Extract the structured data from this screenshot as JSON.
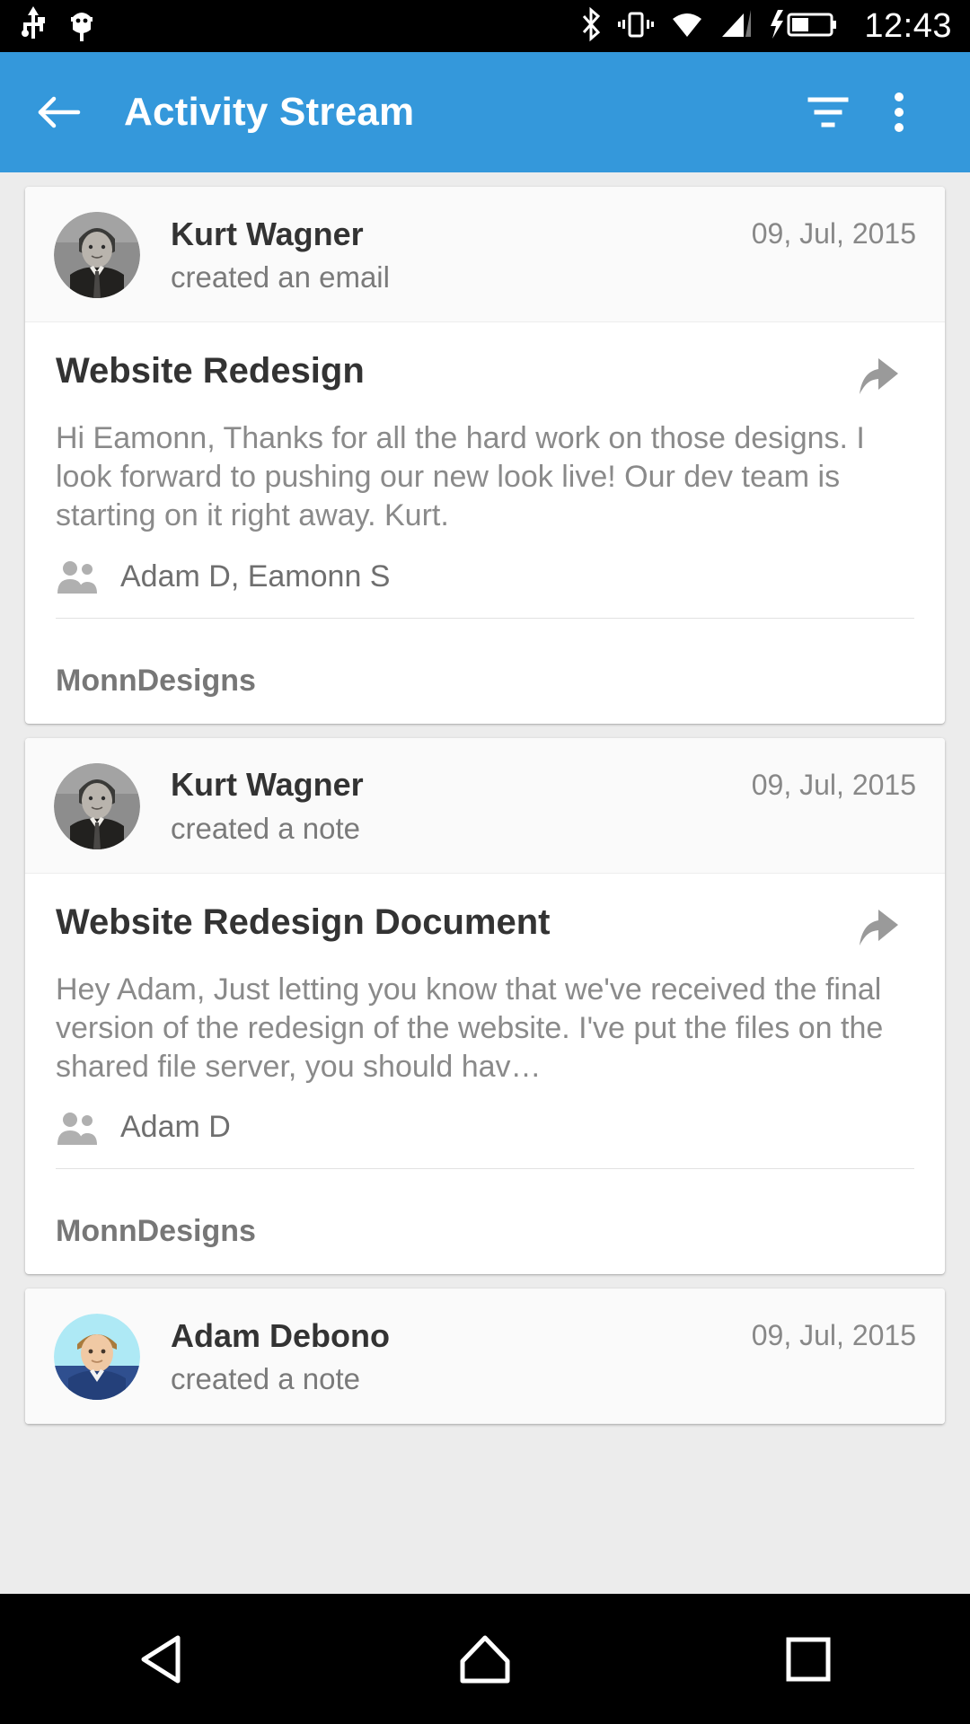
{
  "status_bar": {
    "time": "12:43",
    "icons": [
      "usb-icon",
      "android-debug-icon",
      "bluetooth-icon",
      "vibrate-icon",
      "wifi-icon",
      "cellular-signal-icon",
      "charging-battery-icon"
    ]
  },
  "app_bar": {
    "title": "Activity Stream",
    "back_icon": "back-arrow-icon",
    "filter_icon": "filter-icon",
    "overflow_icon": "overflow-menu-icon"
  },
  "activities": [
    {
      "author": "Kurt Wagner",
      "action": "created an email",
      "date": "09, Jul, 2015",
      "avatar_type": "photo-grayscale-man",
      "title": "Website Redesign",
      "body": "Hi Eamonn, Thanks for all the hard work on those designs. I look forward to pushing our new look live! Our dev team is starting on it right away. Kurt.",
      "participants": "Adam D, Eamonn S",
      "footer": "MonnDesigns",
      "reply_icon": "reply-icon",
      "people_icon": "people-icon"
    },
    {
      "author": "Kurt Wagner",
      "action": "created a note",
      "date": "09, Jul, 2015",
      "avatar_type": "photo-grayscale-man",
      "title": "Website Redesign Document",
      "body": "Hey Adam, Just letting you know that we've received the final version of the redesign of the website. I've put the files on the shared file server, you should hav…",
      "participants": "Adam D",
      "footer": "MonnDesigns",
      "reply_icon": "reply-icon",
      "people_icon": "people-icon"
    },
    {
      "author": "Adam Debono",
      "action": "created a note",
      "date": "09, Jul, 2015",
      "avatar_type": "photo-color-man-blue",
      "title": "",
      "body": "",
      "participants": "",
      "footer": "",
      "reply_icon": "reply-icon",
      "people_icon": "people-icon"
    }
  ],
  "nav_bar": {
    "back_label": "back-triangle-icon",
    "home_label": "home-icon",
    "recents_label": "recents-square-icon"
  },
  "colors": {
    "accent": "#3498db",
    "page_bg": "#ececec",
    "card_bg": "#ffffff",
    "header_bg": "#fafafa",
    "text_primary": "#333333",
    "text_secondary": "#8a8a8a"
  }
}
